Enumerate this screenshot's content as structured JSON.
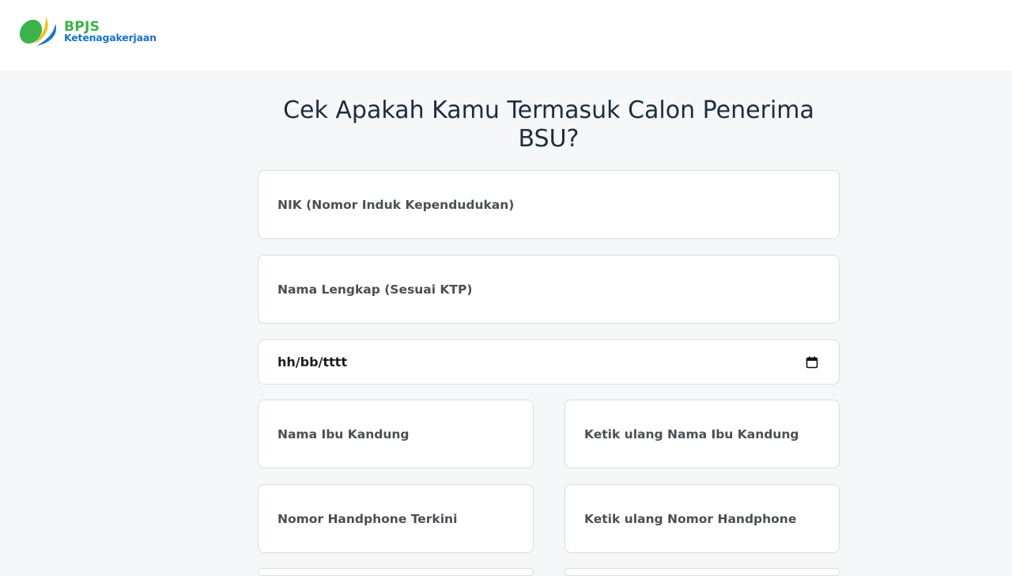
{
  "header": {
    "logo": {
      "line1": "BPJS",
      "line2": "Ketenagakerjaan"
    }
  },
  "title": "Cek Apakah Kamu Termasuk Calon Penerima BSU?",
  "form": {
    "nik_placeholder": "NIK (Nomor Induk Kependudukan)",
    "nama_placeholder": "Nama Lengkap (Sesuai KTP)",
    "dob_placeholder": "hh/bb/tttt",
    "ibu_placeholder": "Nama Ibu Kandung",
    "ibu_confirm_placeholder": "Ketik ulang Nama Ibu Kandung",
    "hp_placeholder": "Nomor Handphone Terkini",
    "hp_confirm_placeholder": "Ketik ulang Nomor Handphone"
  },
  "colors": {
    "brand_green": "#3cb24a",
    "brand_blue": "#1a73c9",
    "background": "#f5f7f9"
  }
}
